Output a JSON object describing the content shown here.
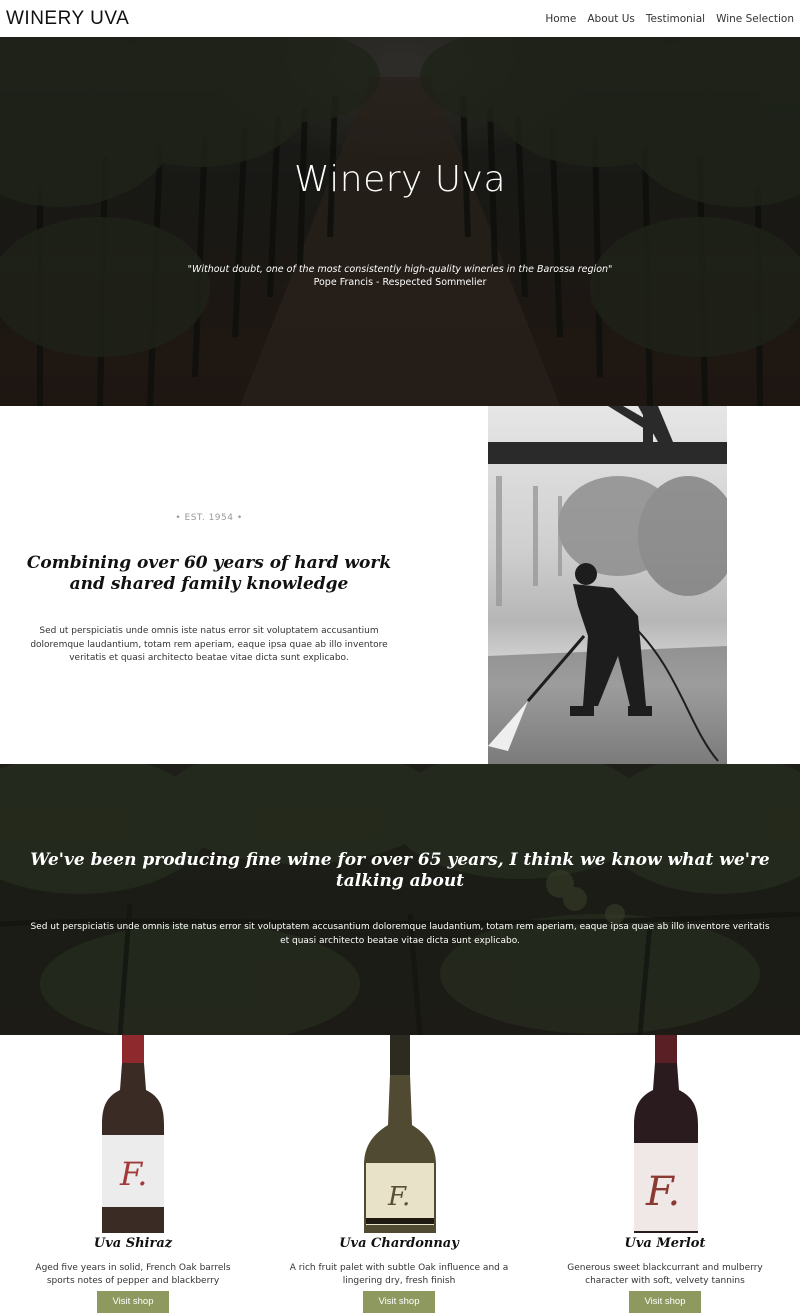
{
  "nav": {
    "brand": "WINERY UVA",
    "links": [
      "Home",
      "About Us",
      "Testimonial",
      "Wine Selection"
    ]
  },
  "hero": {
    "title": "Winery Uva",
    "quote": "\"Without doubt, one of the most consistently high-quality wineries in the Barossa region\"",
    "author": "Pope Francis - Respected Sommelier"
  },
  "about": {
    "est": "• EST. 1954 •",
    "title": "Combining over 60 years of hard work and shared family knowledge",
    "body": "Sed ut perspiciatis unde omnis iste natus error sit voluptatem accusantium doloremque laudantium, totam rem aperiam, eaque ipsa quae ab illo inventore veritatis et quasi architecto beatae vitae dicta sunt explicabo."
  },
  "banner": {
    "title": "We've been producing fine wine for over 65 years, I think we know what we're talking about",
    "body": "Sed ut perspiciatis unde omnis iste natus error sit voluptatem accusantium doloremque laudantium, totam rem aperiam, eaque ipsa quae ab illo inventore veritatis et quasi architecto beatae vitae dicta sunt explicabo."
  },
  "wines": [
    {
      "name": "Uva Shiraz",
      "description": "Aged five years in solid, French Oak barrels sports notes of pepper and blackberry",
      "button": "Visit shop"
    },
    {
      "name": "Uva Chardonnay",
      "description": "A rich fruit palet with subtle Oak influence and a lingering dry, fresh finish",
      "button": "Visit shop"
    },
    {
      "name": "Uva Merlot",
      "description": "Generous sweet blackcurrant and mulberry character with soft, velvety tannins",
      "button": "Visit shop"
    }
  ],
  "colors": {
    "button": "#8e9960",
    "hero_overlay": "#23241f"
  }
}
